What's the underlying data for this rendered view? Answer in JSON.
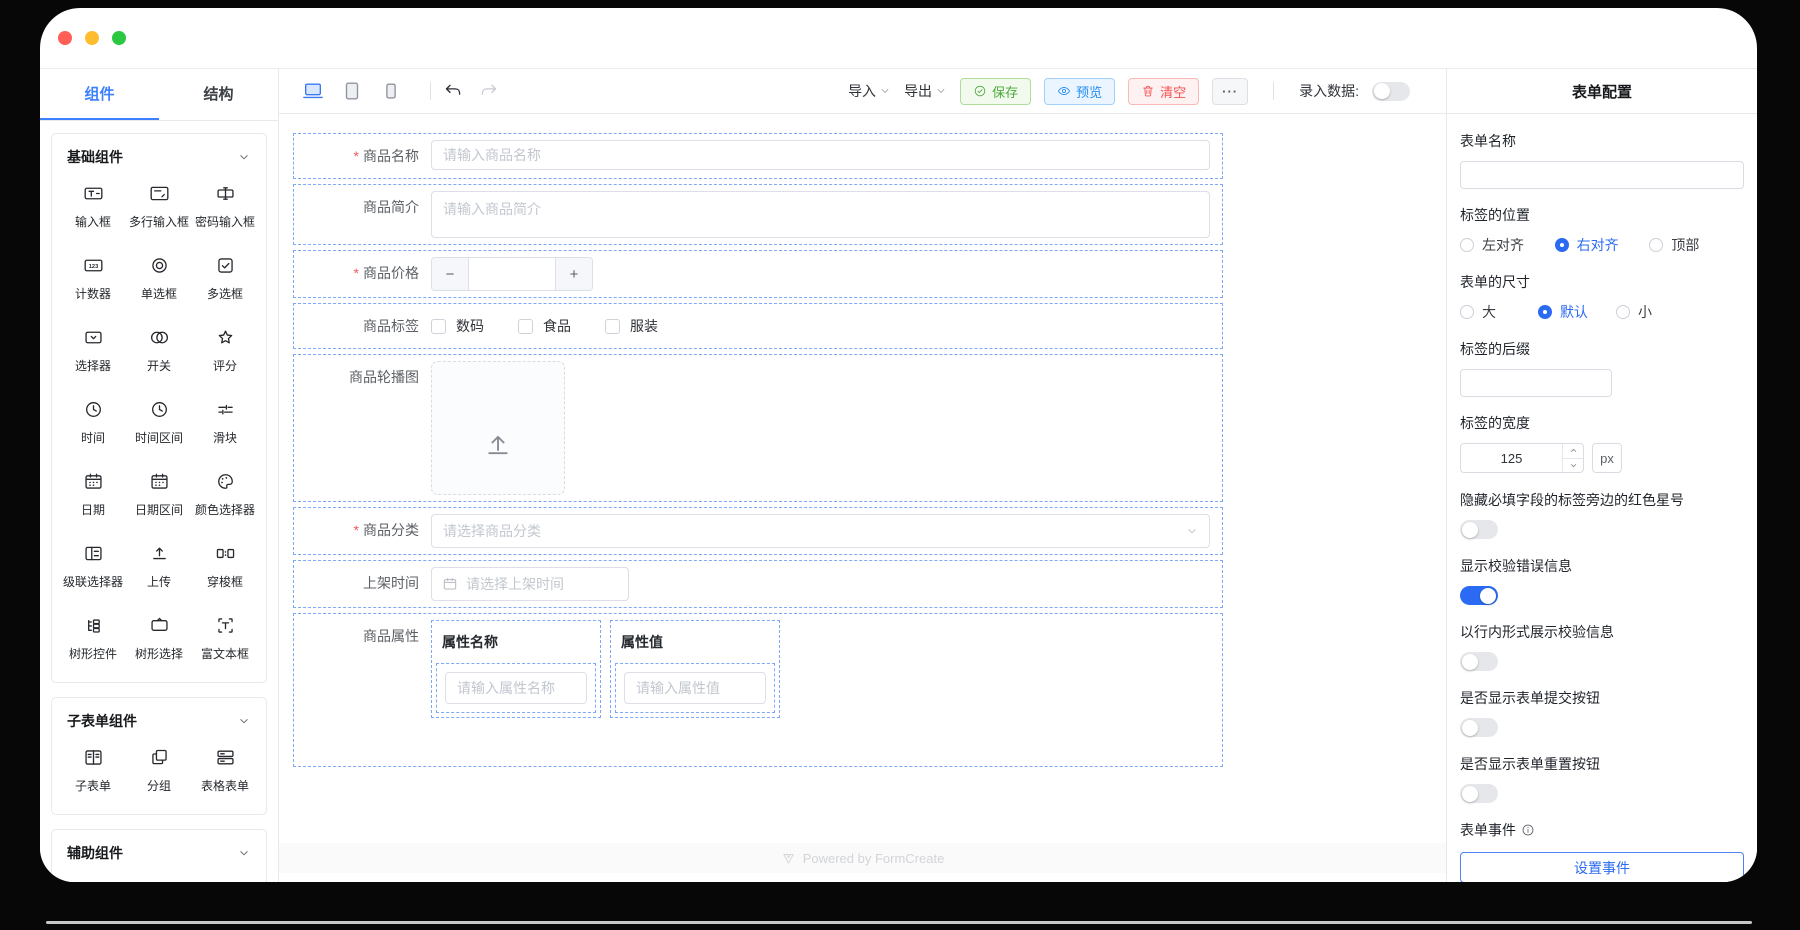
{
  "colors": {
    "accent": "#2b6bf3",
    "tab_blue": "#3d7fff",
    "save_green": "#4ca93c",
    "preview_blue": "#268df2",
    "danger_red": "#f25252",
    "dashed_outline": "#7ea8f8"
  },
  "sidebar": {
    "tabs": [
      {
        "label": "组件",
        "active": true
      },
      {
        "label": "结构",
        "active": false
      }
    ],
    "groups": [
      {
        "title": "基础组件",
        "items": [
          {
            "label": "输入框",
            "icon": "input-icon"
          },
          {
            "label": "多行输入框",
            "icon": "textarea-icon"
          },
          {
            "label": "密码输入框",
            "icon": "password-icon"
          },
          {
            "label": "计数器",
            "icon": "counter-icon"
          },
          {
            "label": "单选框",
            "icon": "radio-icon"
          },
          {
            "label": "多选框",
            "icon": "checkbox-icon"
          },
          {
            "label": "选择器",
            "icon": "select-icon"
          },
          {
            "label": "开关",
            "icon": "switch-icon"
          },
          {
            "label": "评分",
            "icon": "rate-icon"
          },
          {
            "label": "时间",
            "icon": "time-icon"
          },
          {
            "label": "时间区间",
            "icon": "time-range-icon"
          },
          {
            "label": "滑块",
            "icon": "slider-icon"
          },
          {
            "label": "日期",
            "icon": "date-icon"
          },
          {
            "label": "日期区间",
            "icon": "date-range-icon"
          },
          {
            "label": "颜色选择器",
            "icon": "color-picker-icon"
          },
          {
            "label": "级联选择器",
            "icon": "cascader-icon"
          },
          {
            "label": "上传",
            "icon": "upload-icon"
          },
          {
            "label": "穿梭框",
            "icon": "transfer-icon"
          },
          {
            "label": "树形控件",
            "icon": "tree-icon"
          },
          {
            "label": "树形选择",
            "icon": "tree-select-icon"
          },
          {
            "label": "富文本框",
            "icon": "rich-text-icon"
          }
        ]
      },
      {
        "title": "子表单组件",
        "items": [
          {
            "label": "子表单",
            "icon": "subform-icon"
          },
          {
            "label": "分组",
            "icon": "group-icon"
          },
          {
            "label": "表格表单",
            "icon": "table-form-icon"
          }
        ]
      },
      {
        "title": "辅助组件",
        "items": [
          {
            "label": "",
            "icon": "partial-circle-icon"
          },
          {
            "label": "",
            "icon": "partial-rect-icon"
          },
          {
            "label": "",
            "icon": "partial-rect-icon"
          }
        ]
      }
    ]
  },
  "toolbar": {
    "import_label": "导入",
    "export_label": "导出",
    "save_label": "保存",
    "preview_label": "预览",
    "clear_label": "清空",
    "more_label": "···",
    "entry_label": "录入数据:",
    "entry_on": false
  },
  "canvas": {
    "fields": [
      {
        "key": "product-name",
        "type": "input",
        "label": "商品名称",
        "required": true,
        "placeholder": "请输入商品名称"
      },
      {
        "key": "product-intro",
        "type": "textarea",
        "label": "商品简介",
        "required": false,
        "placeholder": "请输入商品简介"
      },
      {
        "key": "product-price",
        "type": "number",
        "label": "商品价格",
        "required": true,
        "value": ""
      },
      {
        "key": "product-tags",
        "type": "checkbox-group",
        "label": "商品标签",
        "required": false,
        "options": [
          "数码",
          "食品",
          "服装"
        ]
      },
      {
        "key": "product-carousel",
        "type": "upload",
        "label": "商品轮播图",
        "required": false
      },
      {
        "key": "product-category",
        "type": "select",
        "label": "商品分类",
        "required": true,
        "placeholder": "请选择商品分类"
      },
      {
        "key": "launch-time",
        "type": "date",
        "label": "上架时间",
        "required": false,
        "placeholder": "请选择上架时间"
      },
      {
        "key": "product-attributes",
        "type": "subform",
        "label": "商品属性",
        "required": false,
        "columns": [
          {
            "title": "属性名称",
            "placeholder": "请输入属性名称"
          },
          {
            "title": "属性值",
            "placeholder": "请输入属性值"
          }
        ]
      }
    ],
    "powered_by": "Powered by FormCreate"
  },
  "config_panel": {
    "title": "表单配置",
    "form_name": {
      "label": "表单名称",
      "value": ""
    },
    "label_position": {
      "label": "标签的位置",
      "options": [
        "左对齐",
        "右对齐",
        "顶部"
      ],
      "selected": "右对齐"
    },
    "form_size": {
      "label": "表单的尺寸",
      "options": [
        "大",
        "默认",
        "小"
      ],
      "selected": "默认"
    },
    "label_suffix": {
      "label": "标签的后缀",
      "value": ""
    },
    "label_width": {
      "label": "标签的宽度",
      "value": "125",
      "unit": "px"
    },
    "toggles": [
      {
        "name": "hide-required-asterisk",
        "label": "隐藏必填字段的标签旁边的红色星号",
        "on": false
      },
      {
        "name": "show-error-message",
        "label": "显示校验错误信息",
        "on": true
      },
      {
        "name": "inline-error-message",
        "label": "以行内形式展示校验信息",
        "on": false
      },
      {
        "name": "show-submit-button",
        "label": "是否显示表单提交按钮",
        "on": false
      },
      {
        "name": "show-reset-button",
        "label": "是否显示表单重置按钮",
        "on": false
      }
    ],
    "form_event": {
      "label": "表单事件",
      "button_label": "设置事件"
    }
  }
}
